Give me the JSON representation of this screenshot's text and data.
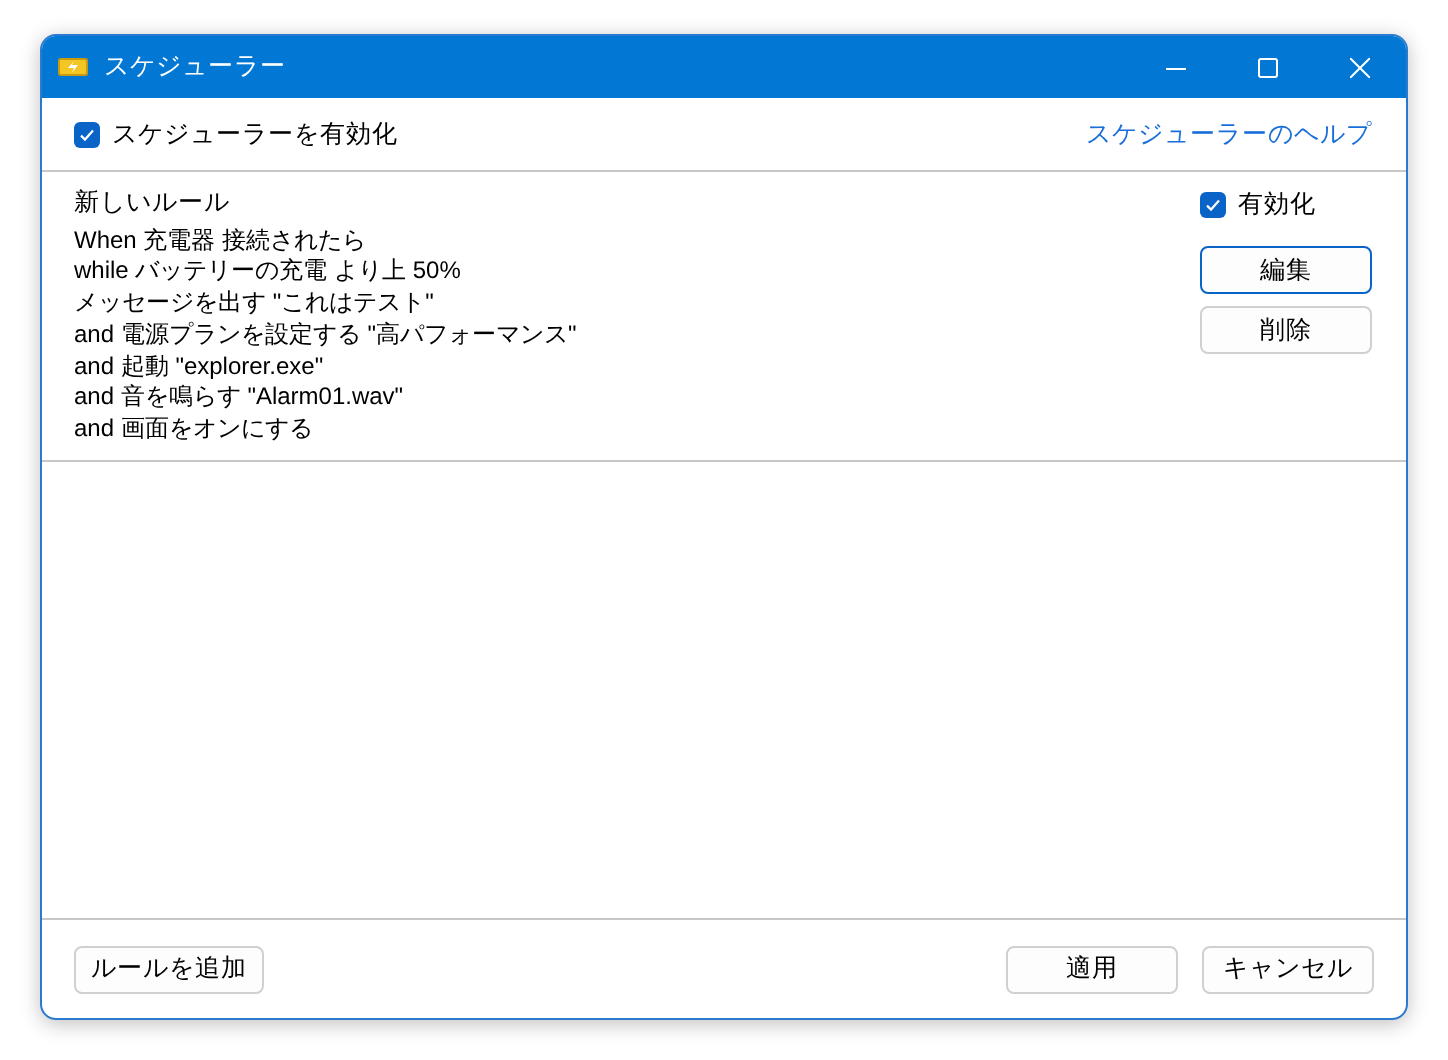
{
  "window": {
    "title": "スケジューラー"
  },
  "header": {
    "enable_scheduler": {
      "label": "スケジューラーを有効化",
      "checked": true
    },
    "help_link": "スケジューラーのヘルプ"
  },
  "rules": [
    {
      "name": "新しいルール",
      "lines": [
        "When 充電器 接続されたら",
        "while バッテリーの充電 より上 50%",
        "メッセージを出す \"これはテスト\"",
        "and 電源プランを設定する \"高パフォーマンス\"",
        "and 起動 \"explorer.exe\"",
        "and 音を鳴らす \"Alarm01.wav\"",
        "and 画面をオンにする"
      ],
      "enabled": {
        "label": "有効化",
        "checked": true
      },
      "buttons": [
        {
          "label": "編集",
          "focused": true
        },
        {
          "label": "削除",
          "focused": false
        }
      ]
    }
  ],
  "footer": {
    "add_button": "ルールを追加",
    "buttons": [
      "適用",
      "キャンセル"
    ]
  }
}
